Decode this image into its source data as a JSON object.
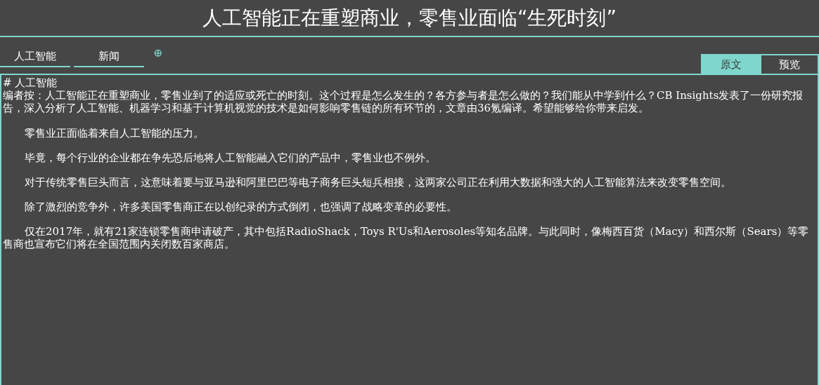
{
  "title": "人工智能正在重塑商业，零售业面临“生死时刻”",
  "tabs": [
    {
      "label": "人工智能"
    },
    {
      "label": "新闻"
    }
  ],
  "add_tab_symbol": "⊕",
  "view_toggle": [
    {
      "label": "原文",
      "selected": true
    },
    {
      "label": "预览",
      "selected": false
    }
  ],
  "editor": {
    "blocks": [
      {
        "kind": "heading",
        "text": "# 人工智能"
      },
      {
        "kind": "note",
        "text": "编者按：人工智能正在重塑商业，零售业到了的适应或死亡的时刻。这个过程是怎么发生的？各方参与者是怎么做的？我们能从中学到什么？CB Insights发表了一份研究报告，深入分析了人工智能、机器学习和基于计算机视觉的技术是如何影响零售链的所有环节的，文章由36氪编译。希望能够给你带来启发。"
      },
      {
        "kind": "paragraph",
        "text": "零售业正面临着来自人工智能的压力。"
      },
      {
        "kind": "paragraph",
        "text": "毕竟，每个行业的企业都在争先恐后地将人工智能融入它们的产品中，零售业也不例外。"
      },
      {
        "kind": "paragraph",
        "text": "对于传统零售巨头而言，这意味着要与亚马逊和阿里巴巴等电子商务巨头短兵相接，这两家公司正在利用大数据和强大的人工智能算法来改变零售空间。"
      },
      {
        "kind": "paragraph",
        "text": "除了激烈的竞争外，许多美国零售商正在以创纪录的方式倒闭，也强调了战略变革的必要性。"
      },
      {
        "kind": "paragraph",
        "text": "仅在2017年，就有21家连锁零售商申请破产，其中包括RadioShack，Toys R'Us和Aerosoles等知名品牌。与此同时，像梅西百货（Macy）和西尔斯（Sears）等零售商也宣布它们将在全国范围内关闭数百家商店。"
      }
    ]
  }
}
